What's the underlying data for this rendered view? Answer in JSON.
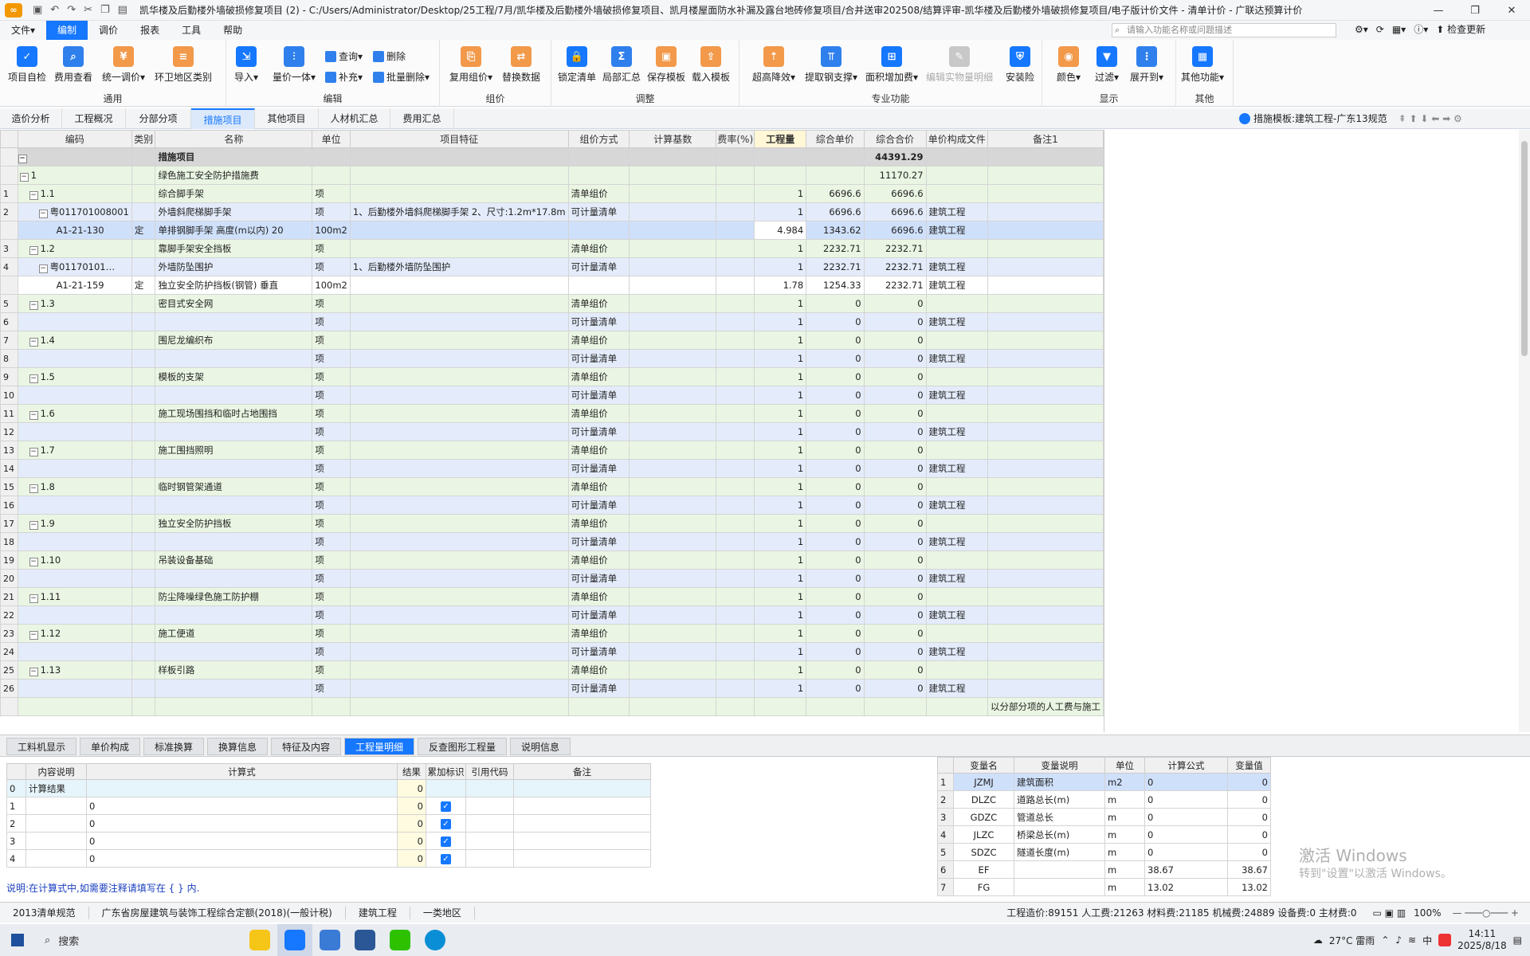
{
  "title": {
    "text": "凯华楼及后勤楼外墙破损修复项目 (2) - C:/Users/Administrator/Desktop/25工程/7月/凯华楼及后勤楼外墙破损修复项目、凯月楼屋面防水补漏及露台地砖修复项目/合并送审202508/结算评审-凯华楼及后勤楼外墙破损修复项目/电子版计价文件 - 清单计价 - 广联达预算计价"
  },
  "menu": {
    "items": [
      "文件▾",
      "编制",
      "调价",
      "报表",
      "工具",
      "帮助"
    ],
    "search_placeholder": "请输入功能名称或问题描述",
    "check_update": "检查更新"
  },
  "ribbon": {
    "groups": [
      "通用",
      "编辑",
      "组价",
      "调整",
      "专业功能",
      "显示",
      "其他"
    ],
    "buttons": {
      "b1": "项目自检",
      "b2": "费用查看",
      "b3": "统一调价▾",
      "b4": "环卫地区类别",
      "b5": "导入▾",
      "b6": "量价一体▾",
      "b7": "查询▾",
      "b8": "补充▾",
      "b9": "删除",
      "b10": "批量删除▾",
      "b11": "复用组价▾",
      "b12": "替换数据",
      "b13": "锁定清单",
      "b14": "局部汇总",
      "b15": "保存模板",
      "b16": "载入模板",
      "b17": "超高降效▾",
      "b18": "提取钢支撑▾",
      "b19": "面积增加费▾",
      "b20": "编辑实物量明细",
      "b21": "安装险",
      "b22": "颜色▾",
      "b23": "过滤▾",
      "b24": "展开到▾",
      "b25": "其他功能▾"
    }
  },
  "tabs": [
    "造价分析",
    "工程概况",
    "分部分项",
    "措施项目",
    "其他项目",
    "人材机汇总",
    "费用汇总"
  ],
  "template_label": "措施模板:建筑工程-广东13规范",
  "grid": {
    "headers": [
      "编码",
      "类别",
      "名称",
      "单位",
      "项目特征",
      "组价方式",
      "计算基数",
      "费率(%)",
      "工程量",
      "综合单价",
      "综合合价",
      "单价构成文件",
      "备注1"
    ],
    "rows": [
      {
        "rn": "",
        "code": "",
        "cat": "",
        "name": "措施项目",
        "unit": "",
        "feat": "",
        "mode": "",
        "base": "",
        "rate": "",
        "qty": "",
        "price": "",
        "total": "44391.29",
        "file": "",
        "note": "",
        "cls": "hdr",
        "tog": "−"
      },
      {
        "rn": "",
        "code": "1",
        "cat": "",
        "name": "绿色施工安全防护措施费",
        "unit": "",
        "feat": "",
        "mode": "",
        "base": "",
        "rate": "",
        "qty": "",
        "price": "",
        "total": "11170.27",
        "file": "",
        "note": "",
        "cls": "grp",
        "tog": "−"
      },
      {
        "rn": "1",
        "code": "1.1",
        "cat": "",
        "name": "综合脚手架",
        "unit": "项",
        "feat": "",
        "mode": "清单组价",
        "base": "",
        "rate": "",
        "qty": "1",
        "price": "6696.6",
        "total": "6696.6",
        "file": "",
        "note": "",
        "cls": "grp",
        "tog": "−"
      },
      {
        "rn": "2",
        "code": "粤011701008001",
        "cat": "",
        "name": "外墙斜爬梯脚手架",
        "unit": "项",
        "feat": "1、后勤楼外墙斜爬梯脚手架 2、尺寸:1.2m*17.8m",
        "mode": "可计量清单",
        "base": "",
        "rate": "",
        "qty": "1",
        "price": "6696.6",
        "total": "6696.6",
        "file": "建筑工程",
        "note": "",
        "cls": "qd",
        "tog": "−"
      },
      {
        "rn": "",
        "code": "A1-21-130",
        "cat": "定",
        "name": "单排钢脚手架 高度(m以内) 20",
        "unit": "100m2",
        "feat": "",
        "mode": "",
        "base": "",
        "rate": "",
        "qty": "4.984",
        "price": "1343.62",
        "total": "6696.6",
        "file": "建筑工程",
        "note": "",
        "cls": "sel",
        "tog": ""
      },
      {
        "rn": "3",
        "code": "1.2",
        "cat": "",
        "name": "靠脚手架安全挡板",
        "unit": "项",
        "feat": "",
        "mode": "清单组价",
        "base": "",
        "rate": "",
        "qty": "1",
        "price": "2232.71",
        "total": "2232.71",
        "file": "",
        "note": "",
        "cls": "grp",
        "tog": "−"
      },
      {
        "rn": "4",
        "code": "粤01170101…",
        "cat": "",
        "name": "外墙防坠围护",
        "unit": "项",
        "feat": "1、后勤楼外墙防坠围护",
        "mode": "可计量清单",
        "base": "",
        "rate": "",
        "qty": "1",
        "price": "2232.71",
        "total": "2232.71",
        "file": "建筑工程",
        "note": "",
        "cls": "qd",
        "tog": "−"
      },
      {
        "rn": "",
        "code": "A1-21-159",
        "cat": "定",
        "name": "独立安全防护挡板(钢管) 垂直",
        "unit": "100m2",
        "feat": "",
        "mode": "",
        "base": "",
        "rate": "",
        "qty": "1.78",
        "price": "1254.33",
        "total": "2232.71",
        "file": "建筑工程",
        "note": "",
        "cls": "de",
        "tog": ""
      },
      {
        "rn": "5",
        "code": "1.3",
        "cat": "",
        "name": "密目式安全网",
        "unit": "项",
        "feat": "",
        "mode": "清单组价",
        "base": "",
        "rate": "",
        "qty": "1",
        "price": "0",
        "total": "0",
        "file": "",
        "note": "",
        "cls": "grp",
        "tog": "−"
      },
      {
        "rn": "6",
        "code": "",
        "cat": "",
        "name": "",
        "unit": "项",
        "feat": "",
        "mode": "可计量清单",
        "base": "",
        "rate": "",
        "qty": "1",
        "price": "0",
        "total": "0",
        "file": "建筑工程",
        "note": "",
        "cls": "qd",
        "tog": ""
      },
      {
        "rn": "7",
        "code": "1.4",
        "cat": "",
        "name": "围尼龙编织布",
        "unit": "项",
        "feat": "",
        "mode": "清单组价",
        "base": "",
        "rate": "",
        "qty": "1",
        "price": "0",
        "total": "0",
        "file": "",
        "note": "",
        "cls": "grp",
        "tog": "−"
      },
      {
        "rn": "8",
        "code": "",
        "cat": "",
        "name": "",
        "unit": "项",
        "feat": "",
        "mode": "可计量清单",
        "base": "",
        "rate": "",
        "qty": "1",
        "price": "0",
        "total": "0",
        "file": "建筑工程",
        "note": "",
        "cls": "qd",
        "tog": ""
      },
      {
        "rn": "9",
        "code": "1.5",
        "cat": "",
        "name": "模板的支架",
        "unit": "项",
        "feat": "",
        "mode": "清单组价",
        "base": "",
        "rate": "",
        "qty": "1",
        "price": "0",
        "total": "0",
        "file": "",
        "note": "",
        "cls": "grp",
        "tog": "−"
      },
      {
        "rn": "10",
        "code": "",
        "cat": "",
        "name": "",
        "unit": "项",
        "feat": "",
        "mode": "可计量清单",
        "base": "",
        "rate": "",
        "qty": "1",
        "price": "0",
        "total": "0",
        "file": "建筑工程",
        "note": "",
        "cls": "qd",
        "tog": ""
      },
      {
        "rn": "11",
        "code": "1.6",
        "cat": "",
        "name": "施工现场围挡和临时占地围挡",
        "unit": "项",
        "feat": "",
        "mode": "清单组价",
        "base": "",
        "rate": "",
        "qty": "1",
        "price": "0",
        "total": "0",
        "file": "",
        "note": "",
        "cls": "grp",
        "tog": "−"
      },
      {
        "rn": "12",
        "code": "",
        "cat": "",
        "name": "",
        "unit": "项",
        "feat": "",
        "mode": "可计量清单",
        "base": "",
        "rate": "",
        "qty": "1",
        "price": "0",
        "total": "0",
        "file": "建筑工程",
        "note": "",
        "cls": "qd",
        "tog": ""
      },
      {
        "rn": "13",
        "code": "1.7",
        "cat": "",
        "name": "施工围挡照明",
        "unit": "项",
        "feat": "",
        "mode": "清单组价",
        "base": "",
        "rate": "",
        "qty": "1",
        "price": "0",
        "total": "0",
        "file": "",
        "note": "",
        "cls": "grp",
        "tog": "−"
      },
      {
        "rn": "14",
        "code": "",
        "cat": "",
        "name": "",
        "unit": "项",
        "feat": "",
        "mode": "可计量清单",
        "base": "",
        "rate": "",
        "qty": "1",
        "price": "0",
        "total": "0",
        "file": "建筑工程",
        "note": "",
        "cls": "qd",
        "tog": ""
      },
      {
        "rn": "15",
        "code": "1.8",
        "cat": "",
        "name": "临时钢管架通道",
        "unit": "项",
        "feat": "",
        "mode": "清单组价",
        "base": "",
        "rate": "",
        "qty": "1",
        "price": "0",
        "total": "0",
        "file": "",
        "note": "",
        "cls": "grp",
        "tog": "−"
      },
      {
        "rn": "16",
        "code": "",
        "cat": "",
        "name": "",
        "unit": "项",
        "feat": "",
        "mode": "可计量清单",
        "base": "",
        "rate": "",
        "qty": "1",
        "price": "0",
        "total": "0",
        "file": "建筑工程",
        "note": "",
        "cls": "qd",
        "tog": ""
      },
      {
        "rn": "17",
        "code": "1.9",
        "cat": "",
        "name": "独立安全防护挡板",
        "unit": "项",
        "feat": "",
        "mode": "清单组价",
        "base": "",
        "rate": "",
        "qty": "1",
        "price": "0",
        "total": "0",
        "file": "",
        "note": "",
        "cls": "grp",
        "tog": "−"
      },
      {
        "rn": "18",
        "code": "",
        "cat": "",
        "name": "",
        "unit": "项",
        "feat": "",
        "mode": "可计量清单",
        "base": "",
        "rate": "",
        "qty": "1",
        "price": "0",
        "total": "0",
        "file": "建筑工程",
        "note": "",
        "cls": "qd",
        "tog": ""
      },
      {
        "rn": "19",
        "code": "1.10",
        "cat": "",
        "name": "吊装设备基础",
        "unit": "项",
        "feat": "",
        "mode": "清单组价",
        "base": "",
        "rate": "",
        "qty": "1",
        "price": "0",
        "total": "0",
        "file": "",
        "note": "",
        "cls": "grp",
        "tog": "−"
      },
      {
        "rn": "20",
        "code": "",
        "cat": "",
        "name": "",
        "unit": "项",
        "feat": "",
        "mode": "可计量清单",
        "base": "",
        "rate": "",
        "qty": "1",
        "price": "0",
        "total": "0",
        "file": "建筑工程",
        "note": "",
        "cls": "qd",
        "tog": ""
      },
      {
        "rn": "21",
        "code": "1.11",
        "cat": "",
        "name": "防尘降噪绿色施工防护棚",
        "unit": "项",
        "feat": "",
        "mode": "清单组价",
        "base": "",
        "rate": "",
        "qty": "1",
        "price": "0",
        "total": "0",
        "file": "",
        "note": "",
        "cls": "grp",
        "tog": "−"
      },
      {
        "rn": "22",
        "code": "",
        "cat": "",
        "name": "",
        "unit": "项",
        "feat": "",
        "mode": "可计量清单",
        "base": "",
        "rate": "",
        "qty": "1",
        "price": "0",
        "total": "0",
        "file": "建筑工程",
        "note": "",
        "cls": "qd",
        "tog": ""
      },
      {
        "rn": "23",
        "code": "1.12",
        "cat": "",
        "name": "施工便道",
        "unit": "项",
        "feat": "",
        "mode": "清单组价",
        "base": "",
        "rate": "",
        "qty": "1",
        "price": "0",
        "total": "0",
        "file": "",
        "note": "",
        "cls": "grp",
        "tog": "−"
      },
      {
        "rn": "24",
        "code": "",
        "cat": "",
        "name": "",
        "unit": "项",
        "feat": "",
        "mode": "可计量清单",
        "base": "",
        "rate": "",
        "qty": "1",
        "price": "0",
        "total": "0",
        "file": "建筑工程",
        "note": "",
        "cls": "qd",
        "tog": ""
      },
      {
        "rn": "25",
        "code": "1.13",
        "cat": "",
        "name": "样板引路",
        "unit": "项",
        "feat": "",
        "mode": "清单组价",
        "base": "",
        "rate": "",
        "qty": "1",
        "price": "0",
        "total": "0",
        "file": "",
        "note": "",
        "cls": "grp",
        "tog": "−"
      },
      {
        "rn": "26",
        "code": "",
        "cat": "",
        "name": "",
        "unit": "项",
        "feat": "",
        "mode": "可计量清单",
        "base": "",
        "rate": "",
        "qty": "1",
        "price": "0",
        "total": "0",
        "file": "建筑工程",
        "note": "",
        "cls": "qd",
        "tog": ""
      },
      {
        "rn": "",
        "code": "",
        "cat": "",
        "name": "",
        "unit": "",
        "feat": "",
        "mode": "",
        "base": "",
        "rate": "",
        "qty": "",
        "price": "",
        "total": "",
        "file": "",
        "note": "以分部分项的人工费与施工",
        "cls": "grp",
        "tog": ""
      }
    ]
  },
  "bottom_tabs": [
    "工料机显示",
    "单价构成",
    "标准换算",
    "换算信息",
    "特征及内容",
    "工程量明细",
    "反查图形工程量",
    "说明信息"
  ],
  "detail": {
    "headers": [
      "",
      "内容说明",
      "计算式",
      "结果",
      "累加标识",
      "引用代码",
      "备注"
    ],
    "rows": [
      {
        "rn": "0",
        "desc": "计算结果",
        "expr": "",
        "res": "0",
        "check": ""
      },
      {
        "rn": "1",
        "desc": "",
        "expr": "0",
        "res": "0",
        "check": "✓"
      },
      {
        "rn": "2",
        "desc": "",
        "expr": "0",
        "res": "0",
        "check": "✓"
      },
      {
        "rn": "3",
        "desc": "",
        "expr": "0",
        "res": "0",
        "check": "✓"
      },
      {
        "rn": "4",
        "desc": "",
        "expr": "0",
        "res": "0",
        "check": "✓"
      }
    ],
    "note": "说明:在计算式中,如需要注释请填写在 { } 内."
  },
  "vars": {
    "headers": [
      "",
      "变量名",
      "变量说明",
      "单位",
      "计算公式",
      "变量值"
    ],
    "rows": [
      {
        "rn": "1",
        "name": "JZMJ",
        "desc": "建筑面积",
        "unit": "m2",
        "expr": "0",
        "val": "0"
      },
      {
        "rn": "2",
        "name": "DLZC",
        "desc": "道路总长(m)",
        "unit": "m",
        "expr": "0",
        "val": "0"
      },
      {
        "rn": "3",
        "name": "GDZC",
        "desc": "管道总长",
        "unit": "m",
        "expr": "0",
        "val": "0"
      },
      {
        "rn": "4",
        "name": "JLZC",
        "desc": "桥梁总长(m)",
        "unit": "m",
        "expr": "0",
        "val": "0"
      },
      {
        "rn": "5",
        "name": "SDZC",
        "desc": "隧道长度(m)",
        "unit": "m",
        "expr": "0",
        "val": "0"
      },
      {
        "rn": "6",
        "name": "EF",
        "desc": "",
        "unit": "m",
        "expr": "38.67",
        "val": "38.67"
      },
      {
        "rn": "7",
        "name": "FG",
        "desc": "",
        "unit": "m",
        "expr": "13.02",
        "val": "13.02"
      }
    ]
  },
  "watermark": {
    "line1": "激活 Windows",
    "line2": "转到\"设置\"以激活 Windows。"
  },
  "status": {
    "items": [
      "2013清单规范",
      "广东省房屋建筑与装饰工程综合定额(2018)(一般计税)",
      "建筑工程",
      "一类地区"
    ],
    "costs": "工程造价:89151  人工费:21263  材料费:21185  机械费:24889  设备费:0  主材费:0",
    "zoom": "100%"
  },
  "taskbar": {
    "search": "搜索",
    "weather": "27°C 雷雨",
    "ime": "中",
    "time": "14:11",
    "date": "2025/8/18"
  },
  "colors": {
    "accent": "#1677ff",
    "selected_row": "#cfe0fb",
    "group_row": "#eaf6e3",
    "list_row": "#e4ecfb"
  }
}
